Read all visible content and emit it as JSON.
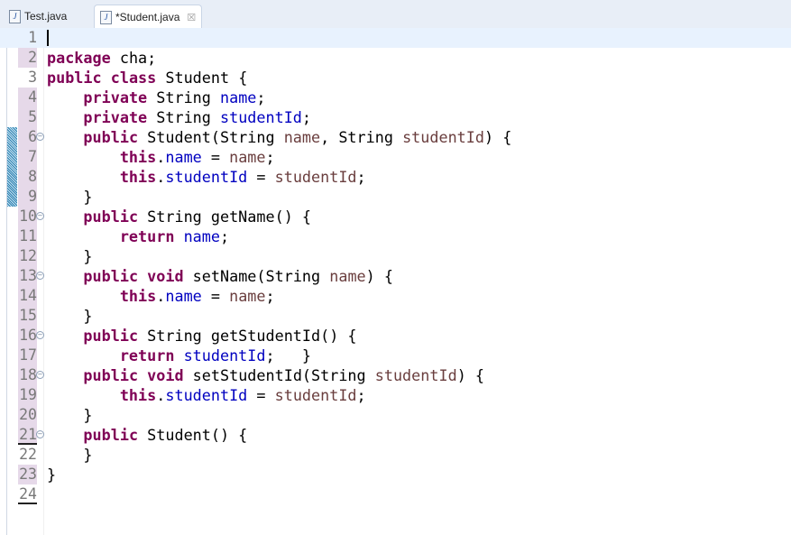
{
  "tabs": [
    {
      "label": "Test.java",
      "icon": "java-file-warning-icon",
      "active": false
    },
    {
      "label": "*Student.java",
      "icon": "java-file-icon",
      "active": true
    }
  ],
  "colors": {
    "keyword": "#7f0055",
    "field": "#0000c0",
    "param": "#6a3e3e",
    "changed": "#e6d9e9",
    "current_line": "#e8f2fe"
  },
  "lines": [
    {
      "n": "1",
      "ch": false,
      "tokens": []
    },
    {
      "n": "2",
      "ch": true,
      "tokens": [
        [
          "package",
          "k"
        ],
        [
          " cha;",
          ""
        ]
      ]
    },
    {
      "n": "3",
      "ch": false,
      "tokens": [
        [
          "public",
          "k"
        ],
        [
          " ",
          ""
        ],
        [
          "class",
          "k"
        ],
        [
          " Student {",
          ""
        ]
      ]
    },
    {
      "n": "4",
      "ch": true,
      "tokens": [
        [
          "    ",
          ""
        ],
        [
          "private",
          "k"
        ],
        [
          " String ",
          ""
        ],
        [
          "name",
          "f"
        ],
        [
          ";",
          ""
        ]
      ]
    },
    {
      "n": "5",
      "ch": true,
      "tokens": [
        [
          "    ",
          ""
        ],
        [
          "private",
          "k"
        ],
        [
          " String ",
          ""
        ],
        [
          "studentId",
          "f"
        ],
        [
          ";",
          ""
        ]
      ]
    },
    {
      "n": "6",
      "ch": true,
      "fold": true,
      "tokens": [
        [
          "    ",
          ""
        ],
        [
          "public",
          "k"
        ],
        [
          " Student(String ",
          ""
        ],
        [
          "name",
          "p"
        ],
        [
          ", String ",
          ""
        ],
        [
          "studentId",
          "p"
        ],
        [
          ") {",
          ""
        ]
      ]
    },
    {
      "n": "7",
      "ch": true,
      "tokens": [
        [
          "        ",
          ""
        ],
        [
          "this",
          "k"
        ],
        [
          ".",
          ""
        ],
        [
          "name",
          "f"
        ],
        [
          " = ",
          ""
        ],
        [
          "name",
          "p"
        ],
        [
          ";",
          ""
        ]
      ]
    },
    {
      "n": "8",
      "ch": true,
      "tokens": [
        [
          "        ",
          ""
        ],
        [
          "this",
          "k"
        ],
        [
          ".",
          ""
        ],
        [
          "studentId",
          "f"
        ],
        [
          " = ",
          ""
        ],
        [
          "studentId",
          "p"
        ],
        [
          ";",
          ""
        ]
      ]
    },
    {
      "n": "9",
      "ch": true,
      "tokens": [
        [
          "    }",
          ""
        ]
      ]
    },
    {
      "n": "10",
      "ch": true,
      "fold": true,
      "tokens": [
        [
          "    ",
          ""
        ],
        [
          "public",
          "k"
        ],
        [
          " String getName() {",
          ""
        ]
      ]
    },
    {
      "n": "11",
      "ch": true,
      "tokens": [
        [
          "        ",
          ""
        ],
        [
          "return",
          "k"
        ],
        [
          " ",
          ""
        ],
        [
          "name",
          "f"
        ],
        [
          ";",
          ""
        ]
      ]
    },
    {
      "n": "12",
      "ch": true,
      "tokens": [
        [
          "    }",
          ""
        ]
      ]
    },
    {
      "n": "13",
      "ch": true,
      "fold": true,
      "tokens": [
        [
          "    ",
          ""
        ],
        [
          "public",
          "k"
        ],
        [
          " ",
          ""
        ],
        [
          "void",
          "k"
        ],
        [
          " setName(String ",
          ""
        ],
        [
          "name",
          "p"
        ],
        [
          ") {",
          ""
        ]
      ]
    },
    {
      "n": "14",
      "ch": true,
      "tokens": [
        [
          "        ",
          ""
        ],
        [
          "this",
          "k"
        ],
        [
          ".",
          ""
        ],
        [
          "name",
          "f"
        ],
        [
          " = ",
          ""
        ],
        [
          "name",
          "p"
        ],
        [
          ";",
          ""
        ]
      ]
    },
    {
      "n": "15",
      "ch": true,
      "tokens": [
        [
          "    }",
          ""
        ]
      ]
    },
    {
      "n": "16",
      "ch": true,
      "fold": true,
      "tokens": [
        [
          "    ",
          ""
        ],
        [
          "public",
          "k"
        ],
        [
          " String getStudentId() {",
          ""
        ]
      ]
    },
    {
      "n": "17",
      "ch": true,
      "tokens": [
        [
          "        ",
          ""
        ],
        [
          "return",
          "k"
        ],
        [
          " ",
          ""
        ],
        [
          "studentId",
          "f"
        ],
        [
          ";   }",
          ""
        ]
      ]
    },
    {
      "n": "18",
      "ch": true,
      "fold": true,
      "tokens": [
        [
          "    ",
          ""
        ],
        [
          "public",
          "k"
        ],
        [
          " ",
          ""
        ],
        [
          "void",
          "k"
        ],
        [
          " setStudentId(String ",
          ""
        ],
        [
          "studentId",
          "p"
        ],
        [
          ") {",
          ""
        ]
      ]
    },
    {
      "n": "19",
      "ch": true,
      "tokens": [
        [
          "        ",
          ""
        ],
        [
          "this",
          "k"
        ],
        [
          ".",
          ""
        ],
        [
          "studentId",
          "f"
        ],
        [
          " = ",
          ""
        ],
        [
          "studentId",
          "p"
        ],
        [
          ";",
          ""
        ]
      ]
    },
    {
      "n": "20",
      "ch": true,
      "tokens": [
        [
          "    }",
          ""
        ]
      ]
    },
    {
      "n": "21",
      "ch": true,
      "fold": true,
      "ul": true,
      "tokens": [
        [
          "    ",
          ""
        ],
        [
          "public",
          "k"
        ],
        [
          " Student() {",
          ""
        ]
      ]
    },
    {
      "n": "22",
      "ch": false,
      "tokens": [
        [
          "    }",
          ""
        ]
      ]
    },
    {
      "n": "23",
      "ch": true,
      "tokens": [
        [
          "}",
          ""
        ]
      ]
    },
    {
      "n": "24",
      "ch": false,
      "ul": true,
      "tokens": []
    }
  ]
}
